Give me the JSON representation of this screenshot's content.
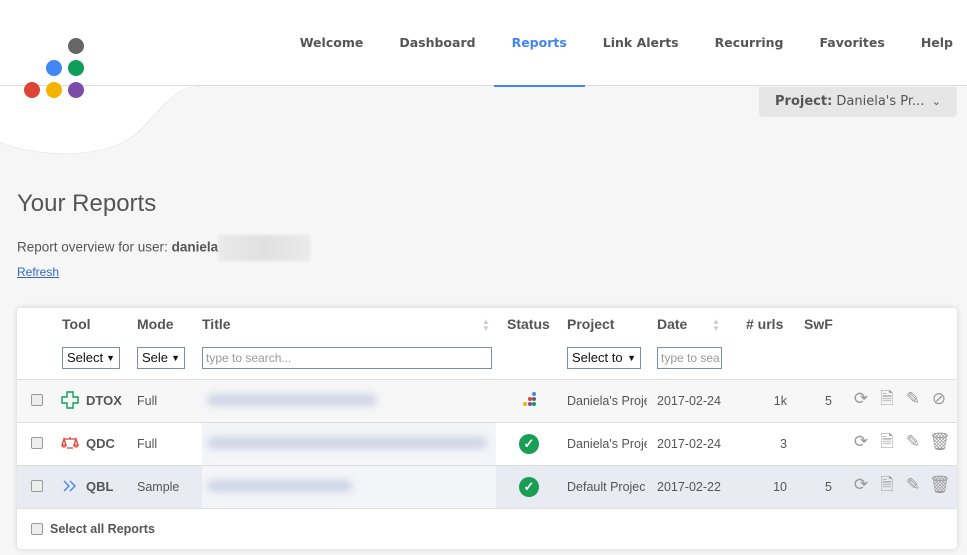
{
  "nav": {
    "items": [
      {
        "label": "Welcome"
      },
      {
        "label": "Dashboard"
      },
      {
        "label": "Reports",
        "active": true
      },
      {
        "label": "Link Alerts"
      },
      {
        "label": "Recurring"
      },
      {
        "label": "Favorites"
      },
      {
        "label": "Help"
      }
    ],
    "accent_color": "#4285f4"
  },
  "logo": {
    "dot_colors": [
      "#666666",
      "#4285f4",
      "#0f9d58",
      "#db4437",
      "#f4b400",
      "#7b4ca8"
    ]
  },
  "project_selector": {
    "label": "Project:",
    "value": "Daniela's Pr..."
  },
  "page": {
    "title": "Your Reports",
    "subtitle_prefix": "Report overview for user:",
    "username": "daniela",
    "refresh_label": "Refresh"
  },
  "table": {
    "headers": {
      "tool": "Tool",
      "mode": "Mode",
      "title": "Title",
      "status": "Status",
      "project": "Project",
      "date": "Date",
      "urls": "# urls",
      "swf": "SwF"
    },
    "filters": {
      "tool": "Select",
      "mode": "Sele",
      "title_placeholder": "type to search...",
      "project": "Select to",
      "date_placeholder": "type to sea"
    },
    "rows": [
      {
        "tool": "DTOX",
        "tool_icon": "plus-cross-icon",
        "tool_color": "#0f9d58",
        "mode": "Full",
        "status": "in-progress",
        "project": "Daniela's Proje",
        "date": "2017-02-24",
        "urls": "1k",
        "swf": "5",
        "last_action": "cancel-icon"
      },
      {
        "tool": "QDC",
        "tool_icon": "scales-icon",
        "tool_color": "#db4437",
        "mode": "Full",
        "status": "done",
        "project": "Daniela's Proje",
        "date": "2017-02-24",
        "urls": "3",
        "swf": "",
        "last_action": "trash-icon"
      },
      {
        "tool": "QBL",
        "tool_icon": "double-chevron-icon",
        "tool_color": "#4285f4",
        "mode": "Sample",
        "status": "done",
        "project": "Default Projec",
        "date": "2017-02-22",
        "urls": "10",
        "swf": "5",
        "last_action": "trash-icon"
      }
    ],
    "select_all_label": "Select all Reports",
    "status_done_color": "#1a9e55"
  }
}
